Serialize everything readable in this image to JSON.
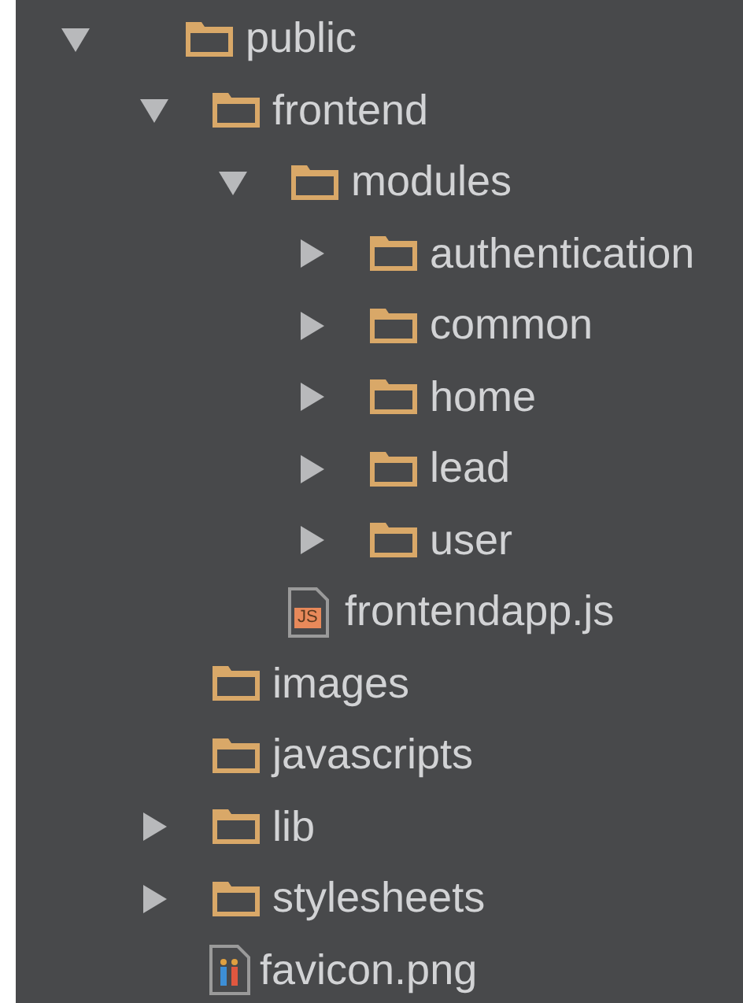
{
  "tree": [
    {
      "kind": "folder",
      "name": "public",
      "expanded": true,
      "children": [
        {
          "kind": "folder",
          "name": "frontend",
          "expanded": true,
          "children": [
            {
              "kind": "folder",
              "name": "modules",
              "expanded": true,
              "children": [
                {
                  "kind": "folder",
                  "name": "authentication",
                  "expanded": false
                },
                {
                  "kind": "folder",
                  "name": "common",
                  "expanded": false
                },
                {
                  "kind": "folder",
                  "name": "home",
                  "expanded": false
                },
                {
                  "kind": "folder",
                  "name": "lead",
                  "expanded": false
                },
                {
                  "kind": "folder",
                  "name": "user",
                  "expanded": false
                }
              ]
            },
            {
              "kind": "script",
              "name": "frontendapp.js",
              "badge": "JS"
            }
          ]
        },
        {
          "kind": "folder",
          "name": "images"
        },
        {
          "kind": "folder",
          "name": "javascripts"
        },
        {
          "kind": "folder",
          "name": "lib",
          "expanded": false
        },
        {
          "kind": "folder",
          "name": "stylesheets",
          "expanded": false
        },
        {
          "kind": "image",
          "name": "favicon.png"
        }
      ]
    }
  ]
}
